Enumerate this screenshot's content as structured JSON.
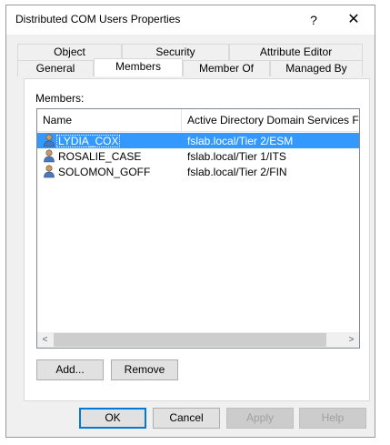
{
  "window": {
    "title": "Distributed COM Users Properties",
    "help_glyph": "?",
    "close_glyph": "✕"
  },
  "tabs": {
    "row1": [
      "Object",
      "Security",
      "Attribute Editor"
    ],
    "row2": [
      "General",
      "Members",
      "Member Of",
      "Managed By"
    ],
    "active": "Members"
  },
  "members": {
    "label": "Members:",
    "columns": [
      "Name",
      "Active Directory Domain Services Folder"
    ],
    "rows": [
      {
        "name": "LYDIA_COX",
        "folder": "fslab.local/Tier 2/ESM",
        "selected": true
      },
      {
        "name": "ROSALIE_CASE",
        "folder": "fslab.local/Tier 1/ITS",
        "selected": false
      },
      {
        "name": "SOLOMON_GOFF",
        "folder": "fslab.local/Tier 2/FIN",
        "selected": false
      }
    ]
  },
  "scroll": {
    "left": "<",
    "right": ">"
  },
  "buttons": {
    "add": "Add...",
    "remove": "Remove",
    "ok": "OK",
    "cancel": "Cancel",
    "apply": "Apply",
    "help": "Help"
  },
  "colors": {
    "selection": "#3399ff",
    "default_button_border": "#0078d7"
  }
}
